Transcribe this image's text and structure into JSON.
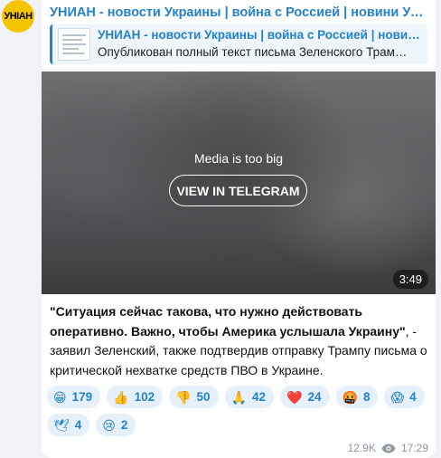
{
  "channel": {
    "avatar_text": "УНІАН",
    "name": "УНИАН - новости Украины | война с Россией | новини Україні…"
  },
  "link_preview": {
    "title": "УНИАН - новости Украины | война с Россией | новини…",
    "description": "Опубликован полный текст письма Зеленского Трам…"
  },
  "media": {
    "message": "Media is too big",
    "button_label": "VIEW IN TELEGRAM",
    "duration": "3:49"
  },
  "post": {
    "quote_bold": "\"Ситуация сейчас такова, что нужно действовать оперативно. Важно, чтобы Америка услышала Украину\"",
    "body": ", - заявил Зеленский, также подтвердив отправку Трампу письма о критической нехватке средств ПВО в Украине."
  },
  "reactions": [
    {
      "emoji": "😁",
      "count": "179"
    },
    {
      "emoji": "👍",
      "count": "102"
    },
    {
      "emoji": "👎",
      "count": "50"
    },
    {
      "emoji": "🙏",
      "count": "42"
    },
    {
      "emoji": "❤️",
      "count": "24"
    },
    {
      "emoji": "🤬",
      "count": "8"
    },
    {
      "emoji": "😱",
      "count": "4"
    },
    {
      "emoji": "🕊",
      "count": "4"
    },
    {
      "emoji": "😢",
      "count": "2"
    }
  ],
  "meta": {
    "views": "12.9K",
    "time": "17:29"
  }
}
